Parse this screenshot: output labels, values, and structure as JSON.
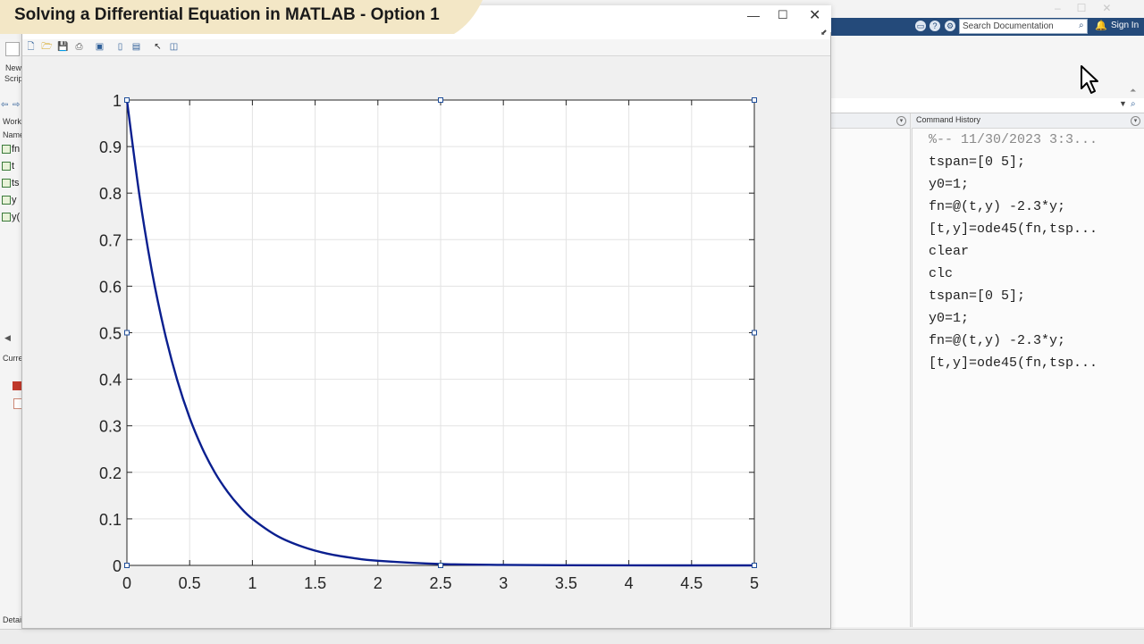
{
  "banner": {
    "title": "Solving a Differential Equation in MATLAB - Option 1"
  },
  "desktop": {
    "search_placeholder": "Search Documentation",
    "sign_in": "Sign In",
    "left_labels": {
      "new_1": "New",
      "new_2": "Scrip",
      "workspace": "Work",
      "name_col": "Name",
      "current": "Curre",
      "details": "Detai"
    },
    "workspace_vars": [
      "fn",
      "t",
      "ts",
      "y",
      "y("
    ],
    "history": {
      "title": "Command History",
      "lines": [
        "%-- 11/30/2023 3:3...",
        "tspan=[0 5];",
        "y0=1;",
        "fn=@(t,y) -2.3*y;",
        "[t,y]=ode45(fn,tsp...",
        "clear",
        "clc",
        "tspan=[0 5];",
        "y0=1;",
        "fn=@(t,y) -2.3*y;",
        "[t,y]=ode45(fn,tsp..."
      ]
    }
  },
  "figure": {
    "window_buttons": {
      "minimize": "—",
      "maximize": "☐",
      "close": "✕"
    }
  },
  "colors": {
    "banner": "#f3e7c6",
    "line": "#0a1f8f",
    "grid": "#e3e3e3",
    "title_strip": "#244a7a"
  },
  "chart_data": {
    "type": "line",
    "title": "",
    "xlabel": "",
    "ylabel": "",
    "xlim": [
      0,
      5
    ],
    "ylim": [
      0,
      1
    ],
    "grid": true,
    "x_ticks": [
      "0",
      "0.5",
      "1",
      "1.5",
      "2",
      "2.5",
      "3",
      "3.5",
      "4",
      "4.5",
      "5"
    ],
    "y_ticks": [
      "0",
      "0.1",
      "0.2",
      "0.3",
      "0.4",
      "0.5",
      "0.6",
      "0.7",
      "0.8",
      "0.9",
      "1"
    ],
    "series": [
      {
        "x": [
          0,
          0.1,
          0.2,
          0.3,
          0.4,
          0.5,
          0.6,
          0.7,
          0.8,
          0.9,
          1.0,
          1.2,
          1.4,
          1.6,
          1.8,
          2.0,
          2.5,
          3.0,
          3.5,
          4.0,
          4.5,
          5.0
        ],
        "values": [
          1.0,
          0.795,
          0.631,
          0.502,
          0.399,
          0.317,
          0.252,
          0.2,
          0.159,
          0.126,
          0.1,
          0.063,
          0.04,
          0.025,
          0.016,
          0.01,
          0.003,
          0.001,
          0.0003,
          0.0001,
          0.0,
          0.0
        ]
      }
    ]
  }
}
